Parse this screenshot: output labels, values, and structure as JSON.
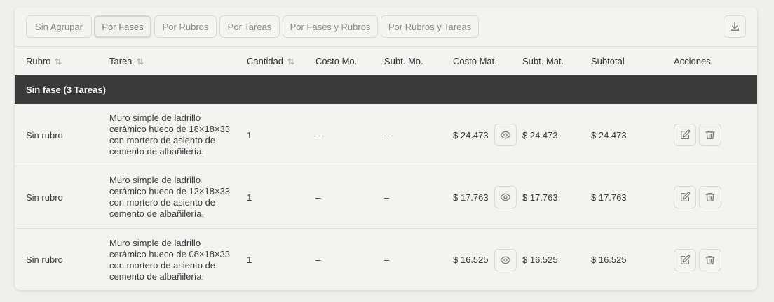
{
  "tabs": [
    {
      "label": "Sin Agrupar",
      "active": false
    },
    {
      "label": "Por Fases",
      "active": true
    },
    {
      "label": "Por Rubros",
      "active": false
    },
    {
      "label": "Por Tareas",
      "active": false
    },
    {
      "label": "Por Fases y Rubros",
      "active": false
    },
    {
      "label": "Por Rubros y Tareas",
      "active": false
    }
  ],
  "download_icon": "download-icon",
  "headers": {
    "rubro": "Rubro",
    "tarea": "Tarea",
    "cantidad": "Cantidad",
    "costo_mo": "Costo Mo.",
    "subt_mo": "Subt. Mo.",
    "costo_mat": "Costo Mat.",
    "subt_mat": "Subt. Mat.",
    "subtotal": "Subtotal",
    "acciones": "Acciones"
  },
  "group": {
    "label": "Sin fase (3 Tareas)"
  },
  "rows": [
    {
      "rubro": "Sin rubro",
      "tarea": "Muro simple de ladrillo cerámico hueco de 18×18×33 con mortero de asiento de cemento de albañilería.",
      "cantidad": "1",
      "costo_mo": "–",
      "subt_mo": "–",
      "costo_mat": "$ 24.473",
      "subt_mat": "$ 24.473",
      "subtotal": "$ 24.473"
    },
    {
      "rubro": "Sin rubro",
      "tarea": "Muro simple de ladrillo cerámico hueco de 12×18×33 con mortero de asiento de cemento de albañilería.",
      "cantidad": "1",
      "costo_mo": "–",
      "subt_mo": "–",
      "costo_mat": "$ 17.763",
      "subt_mat": "$ 17.763",
      "subtotal": "$ 17.763"
    },
    {
      "rubro": "Sin rubro",
      "tarea": "Muro simple de ladrillo cerámico hueco de 08×18×33 con mortero de asiento de cemento de albañilería.",
      "cantidad": "1",
      "costo_mo": "–",
      "subt_mo": "–",
      "costo_mat": "$ 16.525",
      "subt_mat": "$ 16.525",
      "subtotal": "$ 16.525"
    }
  ]
}
